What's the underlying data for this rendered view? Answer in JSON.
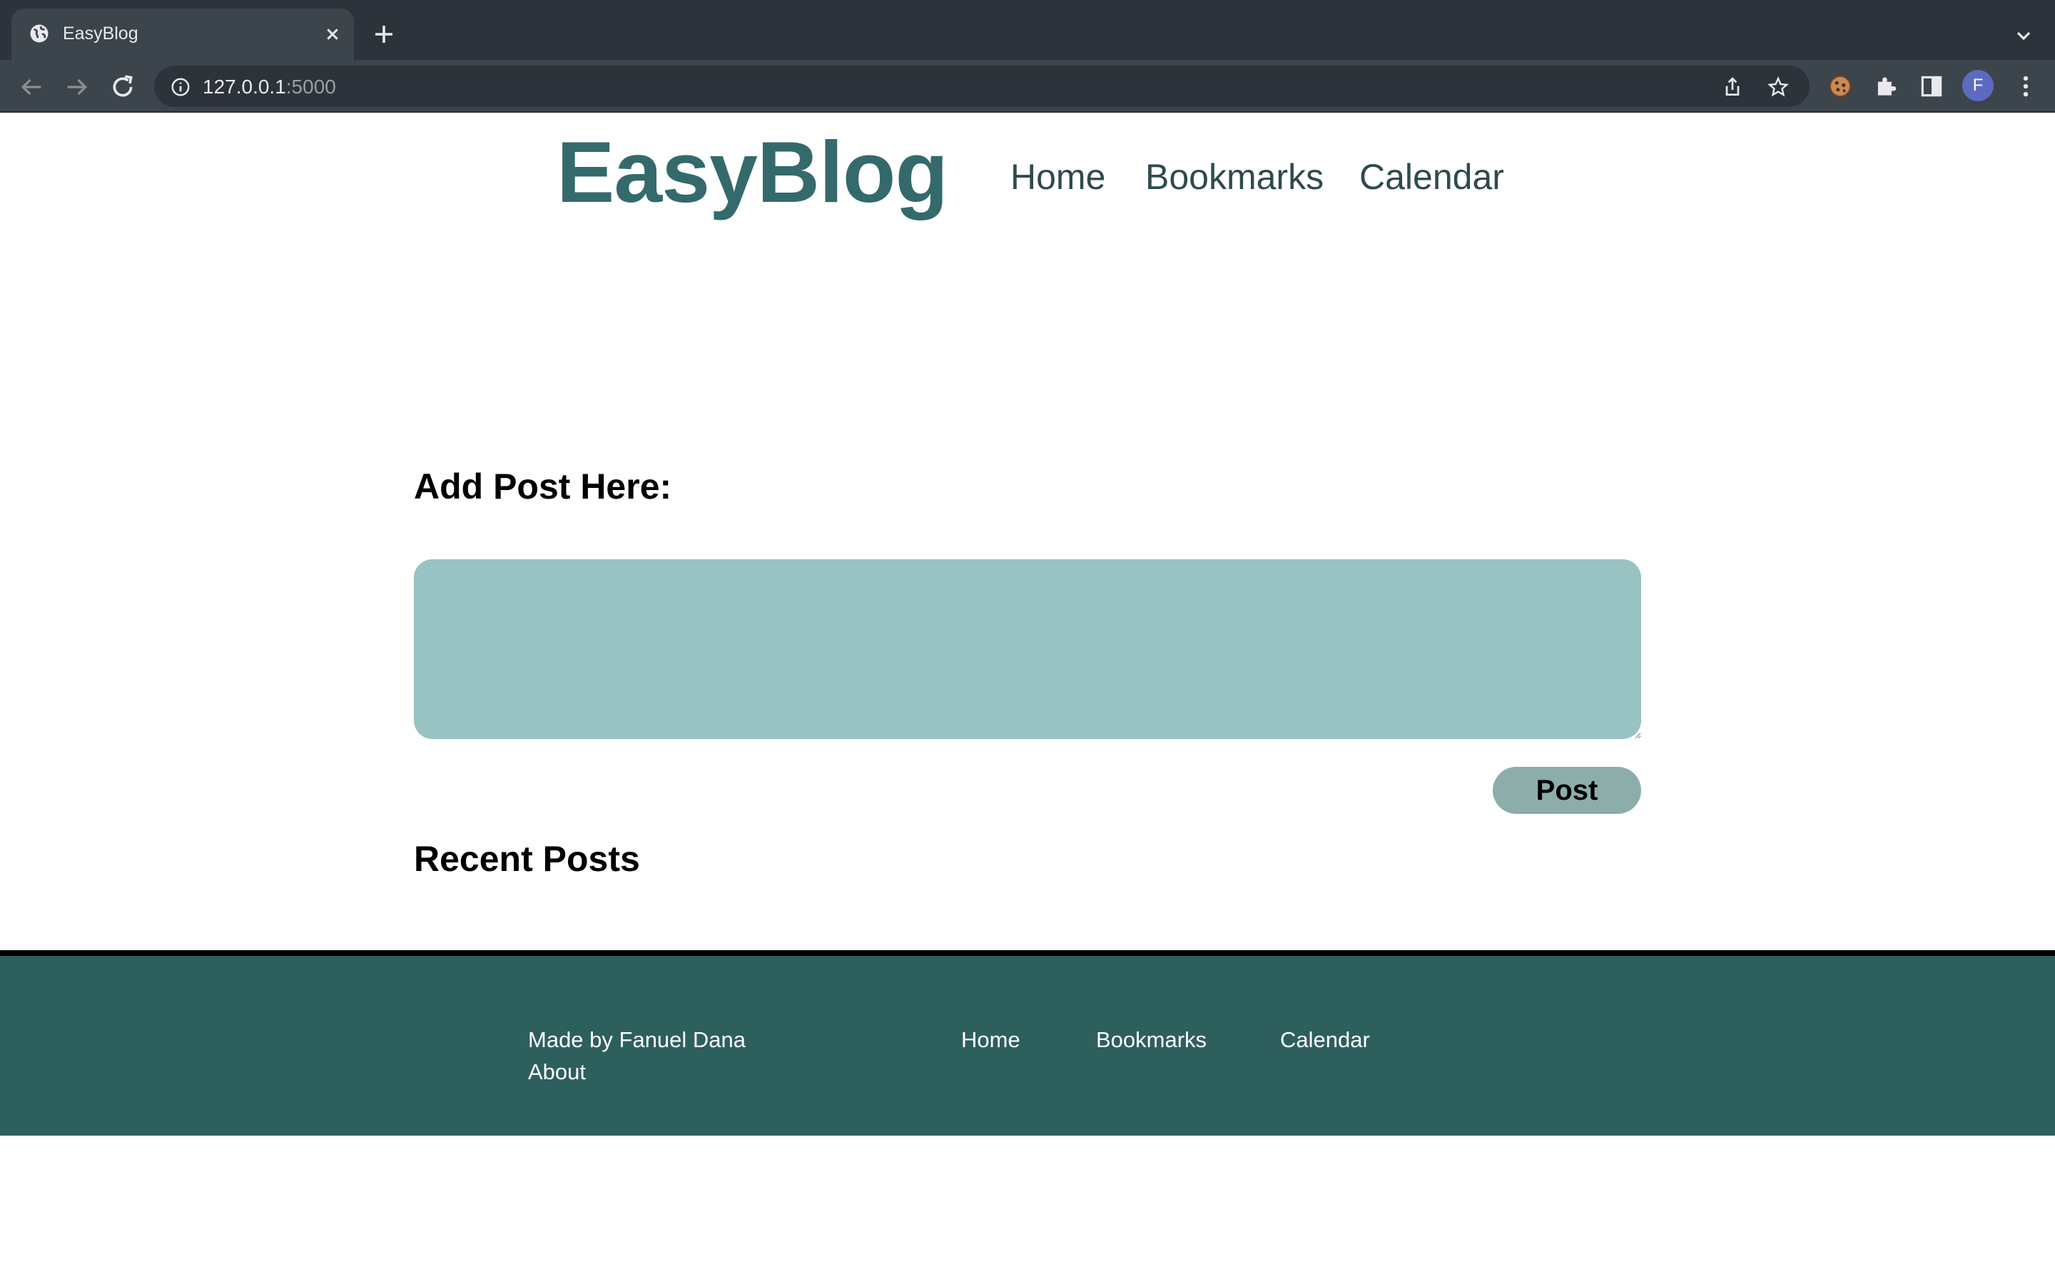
{
  "browser": {
    "tab_title": "EasyBlog",
    "url_host": "127.0.0.1",
    "url_port": ":5000",
    "profile_initial": "F"
  },
  "header": {
    "logo": "EasyBlog",
    "nav": [
      "Home",
      "Bookmarks",
      "Calendar"
    ]
  },
  "main": {
    "add_post_heading": "Add Post Here:",
    "textarea_value": "",
    "post_button": "Post",
    "recent_heading": "Recent Posts"
  },
  "footer": {
    "credit": "Made by Fanuel Dana",
    "about": "About",
    "nav": [
      "Home",
      "Bookmarks",
      "Calendar"
    ]
  },
  "colors": {
    "brand": "#346a6c",
    "textarea_bg": "#99c2c2",
    "button_bg": "#8dadab",
    "footer_bg": "#2d5f5d"
  }
}
